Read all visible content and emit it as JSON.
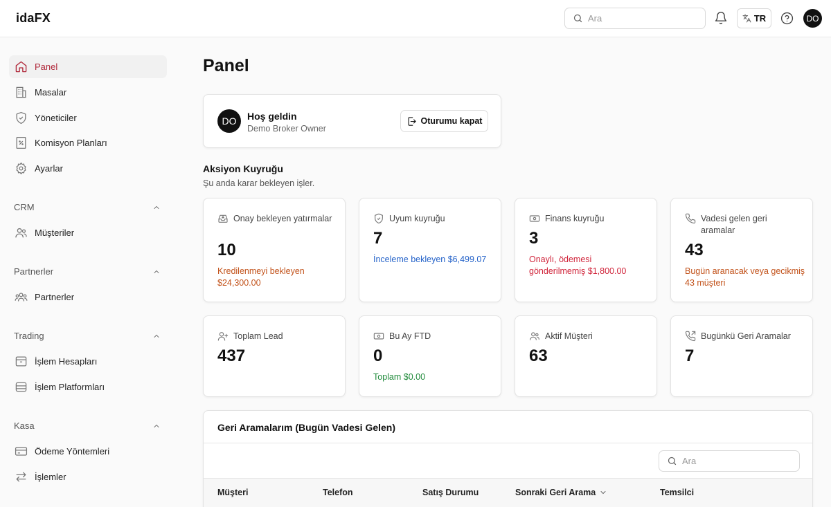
{
  "header": {
    "brand": "idaFX",
    "search_placeholder": "Ara",
    "language": "TR",
    "avatar_initials": "DO"
  },
  "sidebar": {
    "main_items": [
      {
        "label": "Panel",
        "icon": "home-icon",
        "active": true
      },
      {
        "label": "Masalar",
        "icon": "building-icon"
      },
      {
        "label": "Yöneticiler",
        "icon": "shield-icon"
      },
      {
        "label": "Komisyon Planları",
        "icon": "percent-doc-icon"
      },
      {
        "label": "Ayarlar",
        "icon": "gear-icon"
      }
    ],
    "sections": [
      {
        "title": "CRM",
        "items": [
          {
            "label": "Müşteriler",
            "icon": "users-icon"
          }
        ]
      },
      {
        "title": "Partnerler",
        "items": [
          {
            "label": "Partnerler",
            "icon": "group-icon"
          }
        ]
      },
      {
        "title": "Trading",
        "items": [
          {
            "label": "İşlem Hesapları",
            "icon": "archive-icon"
          },
          {
            "label": "İşlem Platformları",
            "icon": "database-icon"
          }
        ]
      },
      {
        "title": "Kasa",
        "items": [
          {
            "label": "Ödeme Yöntemleri",
            "icon": "credit-card-icon"
          },
          {
            "label": "İşlemler",
            "icon": "arrows-swap-icon"
          }
        ]
      }
    ]
  },
  "main": {
    "title": "Panel",
    "welcome": {
      "avatar_initials": "DO",
      "greeting": "Hoş geldin",
      "user": "Demo Broker Owner",
      "logout_label": "Oturumu kapat"
    },
    "action_queue": {
      "title": "Aksiyon Kuyruğu",
      "subtitle": "Şu anda karar bekleyen işler."
    },
    "queue_cards": [
      {
        "label": "Onay bekleyen yatırmalar",
        "value": "10",
        "note": "Kredilenmeyi bekleyen $24,300.00",
        "note_color": "#c2521a",
        "icon": "inbox-icon"
      },
      {
        "label": "Uyum kuyruğu",
        "value": "7",
        "note": "İnceleme bekleyen $6,499.07",
        "note_color": "#2563c9",
        "icon": "shield-check-icon"
      },
      {
        "label": "Finans kuyruğu",
        "value": "3",
        "note": "Onaylı, ödemesi gönderilmemiş $1,800.00",
        "note_color": "#d0243a",
        "icon": "banknote-icon"
      },
      {
        "label": "Vadesi gelen geri aramalar",
        "value": "43",
        "note": "Bugün aranacak veya gecikmiş 43 müşteri",
        "note_color": "#c2521a",
        "icon": "phone-icon"
      }
    ],
    "stat_cards": [
      {
        "label": "Toplam Lead",
        "value": "437",
        "note": "",
        "icon": "user-plus-icon"
      },
      {
        "label": "Bu Ay FTD",
        "value": "0",
        "note": "Toplam $0.00",
        "note_color": "#1f8a3a",
        "icon": "banknote-icon"
      },
      {
        "label": "Aktif Müşteri",
        "value": "63",
        "note": "",
        "icon": "users-icon"
      },
      {
        "label": "Bugünkü Geri Aramalar",
        "value": "7",
        "note": "",
        "icon": "phone-outgoing-icon"
      }
    ],
    "callbacks": {
      "title": "Geri Aramalarım (Bugün Vadesi Gelen)",
      "search_placeholder": "Ara",
      "columns": [
        "Müşteri",
        "Telefon",
        "Satış Durumu",
        "Sonraki Geri Arama",
        "Temsilci"
      ]
    }
  }
}
